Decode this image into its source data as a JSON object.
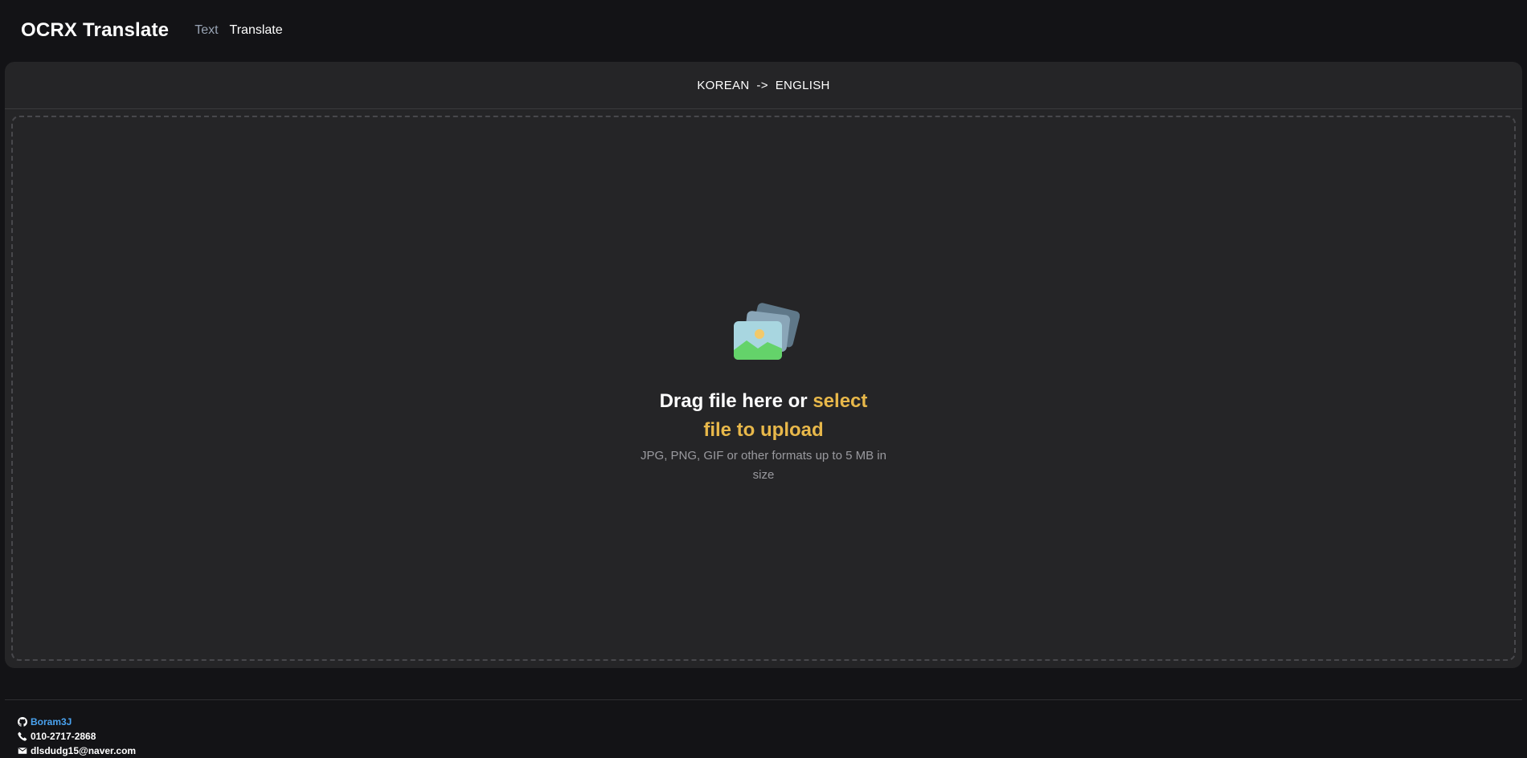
{
  "header": {
    "brand": "OCRX Translate",
    "nav": [
      {
        "label": "Text"
      },
      {
        "label": "Translate"
      }
    ]
  },
  "translation": {
    "source_lang": "KOREAN",
    "arrow": "->",
    "target_lang": "ENGLISH"
  },
  "dropzone": {
    "title_prefix": "Drag file here or ",
    "title_link": "select file to upload",
    "subtitle": "JPG, PNG, GIF or other formats up to 5 MB in size",
    "icon": "image-stack-icon"
  },
  "footer": {
    "github": "Boram3J",
    "phone": "010-2717-2868",
    "email": "dlsdudg15@naver.com",
    "icons": [
      "github-icon",
      "phone-icon",
      "mail-icon"
    ]
  },
  "colors": {
    "background": "#131316",
    "panel": "#252527",
    "accent": "#e8b84a",
    "link": "#4aa3f0",
    "muted_nav": "#98a3b3"
  }
}
